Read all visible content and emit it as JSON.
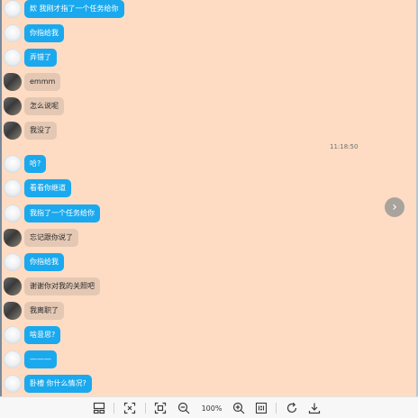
{
  "messages": [
    {
      "text": "欸  我刚才指了一个任务给你",
      "style": "blue"
    },
    {
      "text": "你指给我",
      "style": "blue"
    },
    {
      "text": "弄错了",
      "style": "blue"
    },
    {
      "text": "emmm",
      "style": "tan"
    },
    {
      "text": "怎么说呢",
      "style": "tan"
    },
    {
      "text": "我没了",
      "style": "tan"
    },
    {
      "text": "哈?",
      "style": "blue"
    },
    {
      "text": "看看你继道",
      "style": "blue"
    },
    {
      "text": "我指了一个任务给你",
      "style": "blue"
    },
    {
      "text": "忘记跟你说了",
      "style": "tan"
    },
    {
      "text": "你指给我",
      "style": "blue"
    },
    {
      "text": "谢谢你对我的关照吧",
      "style": "tan"
    },
    {
      "text": "我离职了",
      "style": "tan"
    },
    {
      "text": "啥意思?",
      "style": "blue"
    },
    {
      "text": "———",
      "style": "blue"
    },
    {
      "text": "卧槽  你什么情况?",
      "style": "blue"
    }
  ],
  "timestamp": "11:18:50",
  "toolbar": {
    "zoom_level": "100%"
  },
  "colors": {
    "chat_background": "#fedcc4",
    "blue_bubble": "#1aa9ee",
    "tan_bubble": "#e4c8b4"
  }
}
